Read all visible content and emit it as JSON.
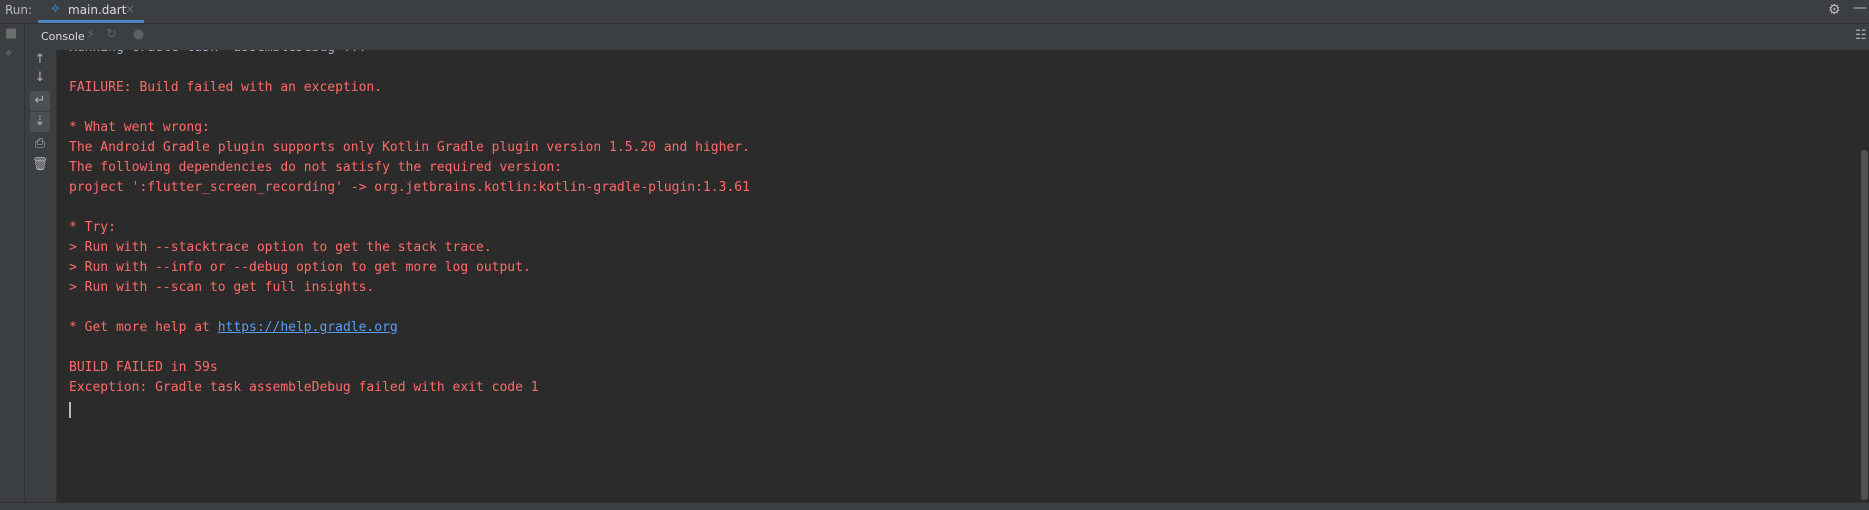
{
  "run_bar": {
    "label": "Run:",
    "tab": {
      "label": "main.dart",
      "icon": "flutter-dart-icon",
      "close": "×"
    },
    "settings_icon": "gear-icon",
    "minimize_icon": "minimize-icon",
    "colors": {
      "accent": "#4a88c7",
      "tab_icon": "#40a3f0"
    }
  },
  "toolbar": {
    "console_tab_label": "Console",
    "icons": [
      "lightning-icon",
      "reload-icon",
      "stop-circle-icon",
      "layout-icon"
    ]
  },
  "left_rail": {
    "icons": [
      "stop-icon",
      "pin-icon"
    ]
  },
  "console_controls": {
    "icons": [
      "arrow-up-icon",
      "arrow-down-icon",
      "soft-wrap-icon",
      "scroll-to-end-icon",
      "print-icon",
      "trash-icon"
    ]
  },
  "console": {
    "lines": [
      "Running Gradle task 'assembleDebug'...",
      "",
      "FAILURE: Build failed with an exception.",
      "",
      "* What went wrong:",
      "The Android Gradle plugin supports only Kotlin Gradle plugin version 1.5.20 and higher.",
      "The following dependencies do not satisfy the required version:",
      "project ':flutter_screen_recording' -> org.jetbrains.kotlin:kotlin-gradle-plugin:1.3.61",
      "",
      "* Try:",
      "> Run with --stacktrace option to get the stack trace.",
      "> Run with --info or --debug option to get more log output.",
      "> Run with --scan to get full insights.",
      "",
      "* Get more help at ",
      "",
      "BUILD FAILED in 59s",
      "Exception: Gradle task assembleDebug failed with exit code 1"
    ],
    "help_link": "https://help.gradle.org",
    "colors": {
      "normal": "#a9b7c6",
      "error": "#ff6b68",
      "link": "#589df6",
      "background": "#2b2b2b"
    }
  }
}
